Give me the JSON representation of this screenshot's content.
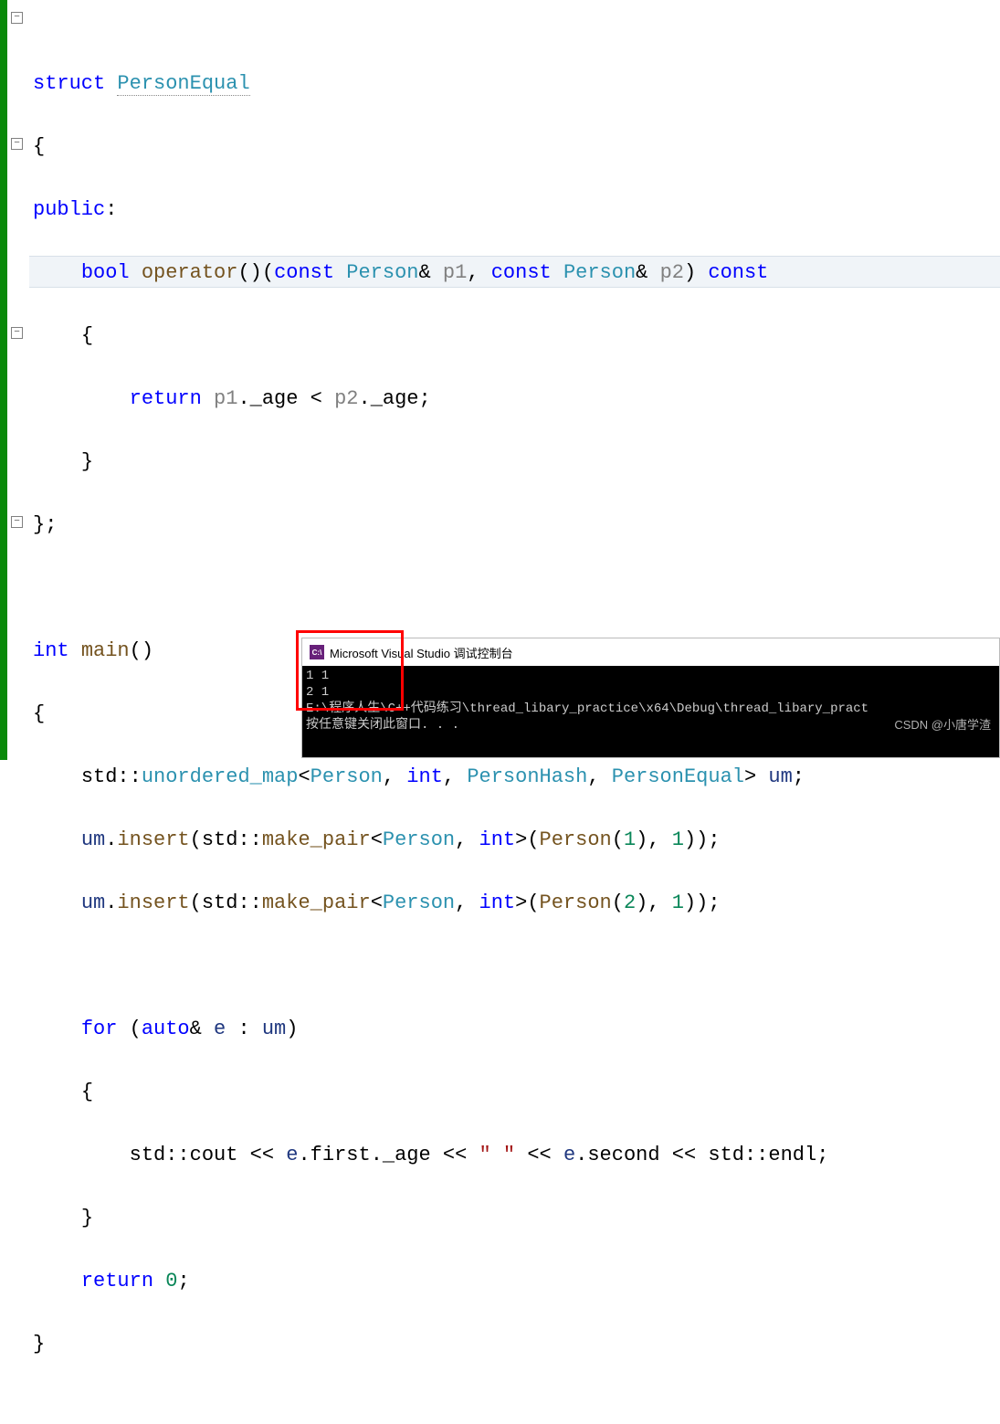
{
  "code": {
    "struct_kw": "struct",
    "struct_name": "PersonEqual",
    "brace_open": "{",
    "public_kw": "public",
    "colon": ":",
    "bool_kw": "bool",
    "operator_kw": "operator",
    "parens": "()",
    "const_kw": "const",
    "Person": "Person",
    "amp": "&",
    "p1": "p1",
    "p2": "p2",
    "comma": ",",
    "return_kw": "return",
    "dot": ".",
    "age": "_age",
    "lt": "<",
    "semi": ";",
    "brace_close": "}",
    "struct_end": "};",
    "int_kw": "int",
    "main": "main",
    "std": "std",
    "dcolon": "::",
    "unordered_map": "unordered_map",
    "PersonHash": "PersonHash",
    "gt": ">",
    "um": "um",
    "insert": "insert",
    "make_pair": "make_pair",
    "one": "1",
    "two": "2",
    "for_kw": "for",
    "auto_kw": "auto",
    "e": "e",
    "in": ":",
    "cout": "cout",
    "lshift": "<<",
    "first": "first",
    "second": "second",
    "space_str": "\" \"",
    "endl": "endl",
    "zero": "0"
  },
  "console": {
    "title": "Microsoft Visual Studio 调试控制台",
    "icon_text": "C:\\",
    "out1": "1 1",
    "out2": "2 1",
    "blank": "",
    "path": "E:\\程序人生\\C++代码练习\\thread_libary_practice\\x64\\Debug\\thread_libary_pract",
    "prompt": "按任意键关闭此窗口. . ."
  },
  "watermark": "CSDN @小唐学渣",
  "fold_glyph": "−"
}
